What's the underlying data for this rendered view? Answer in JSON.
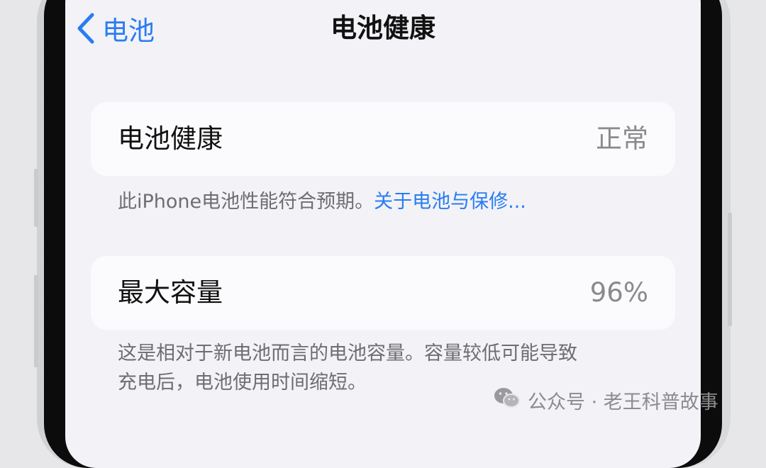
{
  "nav": {
    "back_label": "电池",
    "title": "电池健康"
  },
  "health": {
    "label": "电池健康",
    "value": "正常",
    "footnote_text": "此iPhone电池性能符合预期。",
    "footnote_link": "关于电池与保修..."
  },
  "capacity": {
    "label": "最大容量",
    "value": "96%",
    "footnote_line1": "这是相对于新电池而言的电池容量。容量较低可能导致",
    "footnote_line2": "充电后，电池使用时间缩短。"
  },
  "watermark": {
    "text": "公众号 · 老王科普故事"
  },
  "colors": {
    "accent": "#2a7cf0",
    "background": "#f2f2f7",
    "card": "#fbfbfd",
    "secondary_text": "#8a8a8e"
  },
  "icons": {
    "back": "chevron-left-icon",
    "watermark": "wechat-icon"
  }
}
